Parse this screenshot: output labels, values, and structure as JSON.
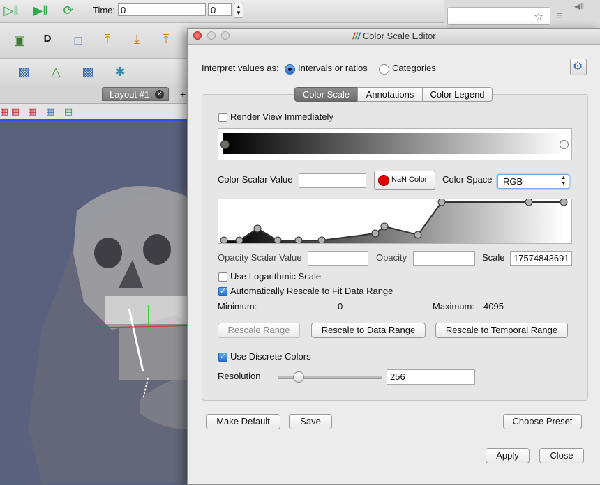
{
  "background": {
    "time_label": "Time:",
    "time_value": "0",
    "time_step": "0",
    "layout_tab": "Layout #1",
    "add_tab": "+"
  },
  "dialog": {
    "title": "Color Scale Editor",
    "interpret_label": "Interpret values as:",
    "interpret_options": [
      "Intervals or ratios",
      "Categories"
    ],
    "tabs": [
      "Color Scale",
      "Annotations",
      "Color Legend"
    ],
    "render_view_immediately": "Render View Immediately",
    "color_scalar_label": "Color Scalar Value",
    "color_scalar_value": "",
    "nan_color_label": "NaN Color",
    "nan_color": "#e00000",
    "color_space_label": "Color Space",
    "color_space_value": "RGB",
    "opacity_scalar_label": "Opacity Scalar Value",
    "opacity_scalar_value": "",
    "opacity_label": "Opacity",
    "opacity_value": "",
    "scale_label": "Scale",
    "scale_value": "17574843691",
    "use_log_scale": "Use Logarithmic Scale",
    "auto_rescale": "Automatically Rescale to Fit Data Range",
    "minimum_label": "Minimum:",
    "minimum_value": "0",
    "maximum_label": "Maximum:",
    "maximum_value": "4095",
    "rescale_range": "Rescale Range",
    "rescale_data_range": "Rescale to Data Range",
    "rescale_temporal_range": "Rescale to Temporal Range",
    "use_discrete_colors": "Use Discrete Colors",
    "resolution_label": "Resolution",
    "resolution_value": "256",
    "resolution_slider_fraction": 0.17,
    "make_default": "Make Default",
    "save": "Save",
    "choose_preset": "Choose Preset",
    "apply": "Apply",
    "close": "Close"
  },
  "colors": {
    "accent": "#2a72d2",
    "view_border": "#2c58d9",
    "render_background": "#59617e"
  }
}
